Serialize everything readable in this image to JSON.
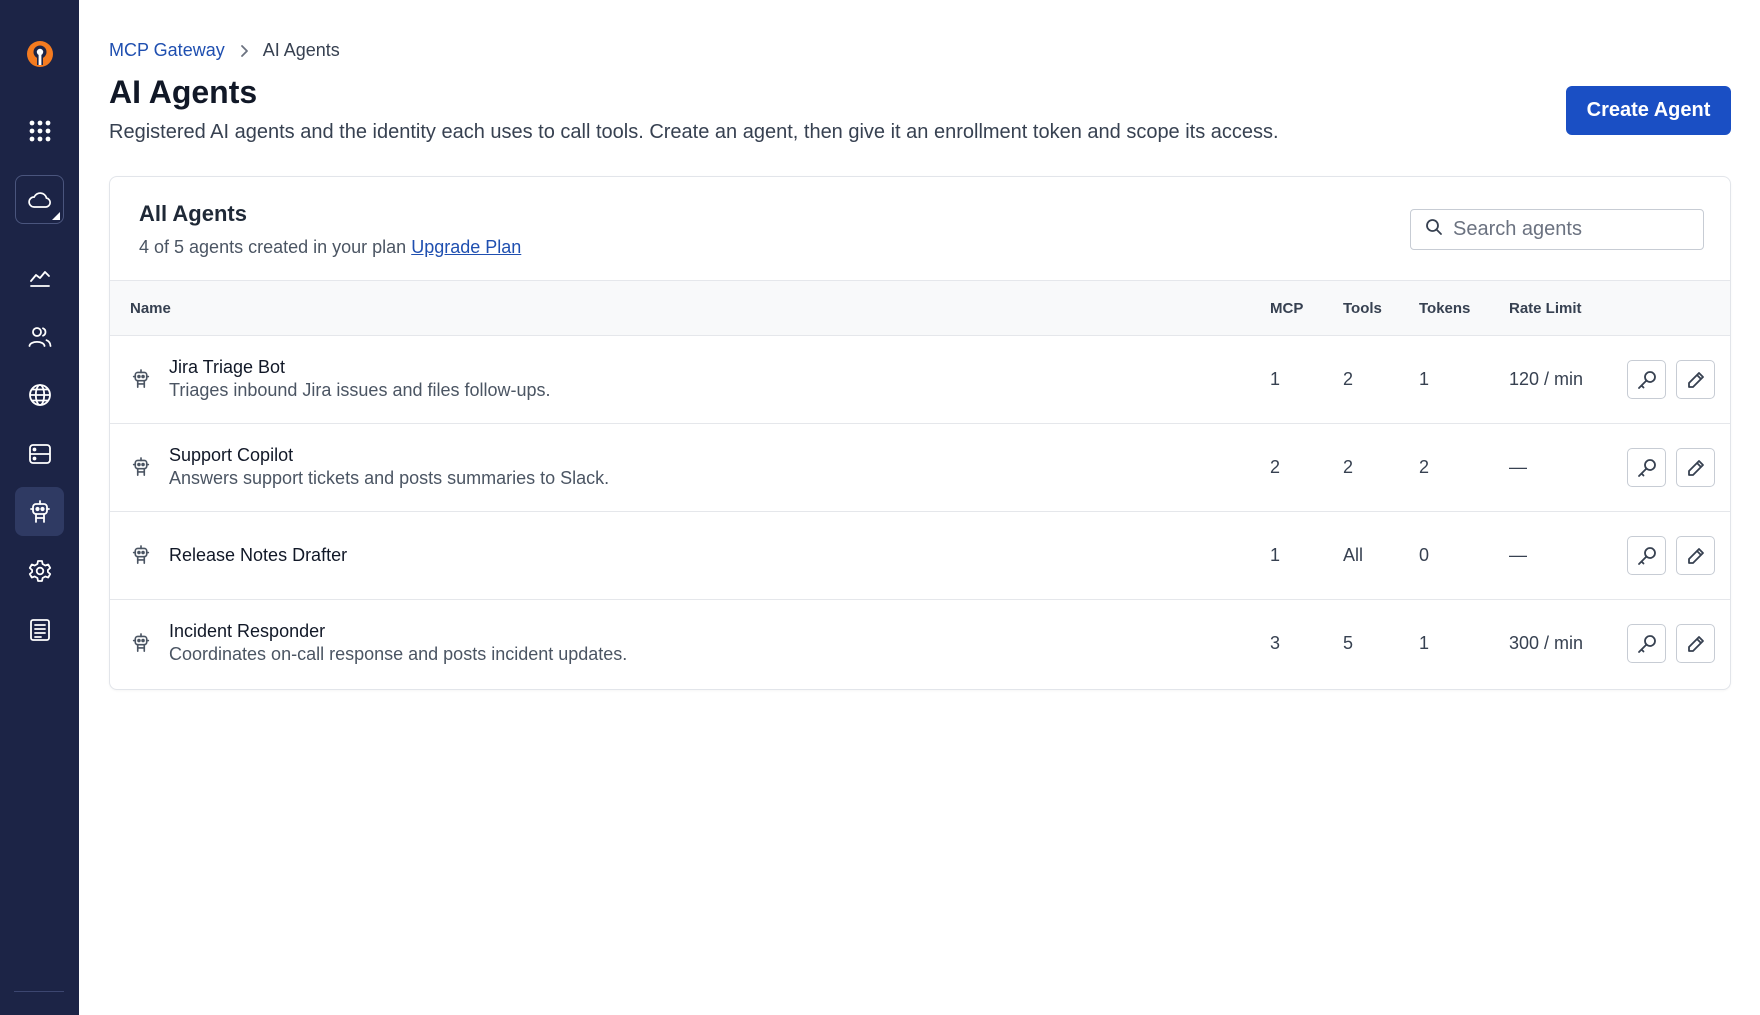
{
  "sidebar": {
    "items": [
      {
        "icon": "logo-icon"
      },
      {
        "icon": "apps-grid-icon"
      },
      {
        "icon": "cloud-icon"
      },
      {
        "icon": "analytics-icon"
      },
      {
        "icon": "users-icon"
      },
      {
        "icon": "globe-icon"
      },
      {
        "icon": "server-icon"
      },
      {
        "icon": "robot-icon",
        "active": true
      },
      {
        "icon": "gear-icon"
      },
      {
        "icon": "docs-icon"
      }
    ],
    "logo_color": "#f47b20",
    "bg_color": "#1c2446"
  },
  "breadcrumb": {
    "parent": "MCP Gateway",
    "current": "AI Agents"
  },
  "page": {
    "title": "AI Agents",
    "description": "Registered AI agents and the identity each uses to call tools. Create an agent, then give it an enrollment token and scope its access.",
    "create_button": "Create Agent"
  },
  "card": {
    "title": "All Agents",
    "subtitle": "4 of 5 agents created in your plan",
    "upgrade_link": "Upgrade Plan",
    "search_placeholder": "Search agents"
  },
  "table": {
    "columns": [
      "Name",
      "MCP",
      "Tools",
      "Tokens",
      "Rate Limit"
    ],
    "rows": [
      {
        "name": "Jira Triage Bot",
        "description": "Triages inbound Jira issues and files follow-ups.",
        "mcp": "1",
        "tools": "2",
        "tokens": "1",
        "rate_limit": "120 / min"
      },
      {
        "name": "Support Copilot",
        "description": "Answers support tickets and posts summaries to Slack.",
        "mcp": "2",
        "tools": "2",
        "tokens": "2",
        "rate_limit": "—"
      },
      {
        "name": "Release Notes Drafter",
        "description": "",
        "mcp": "1",
        "tools": "All",
        "tokens": "0",
        "rate_limit": "—"
      },
      {
        "name": "Incident Responder",
        "description": "Coordinates on-call response and posts incident updates.",
        "mcp": "3",
        "tools": "5",
        "tokens": "1",
        "rate_limit": "300 / min"
      }
    ]
  },
  "colors": {
    "accent": "#1a4fc4",
    "link": "#1f4fb0"
  }
}
